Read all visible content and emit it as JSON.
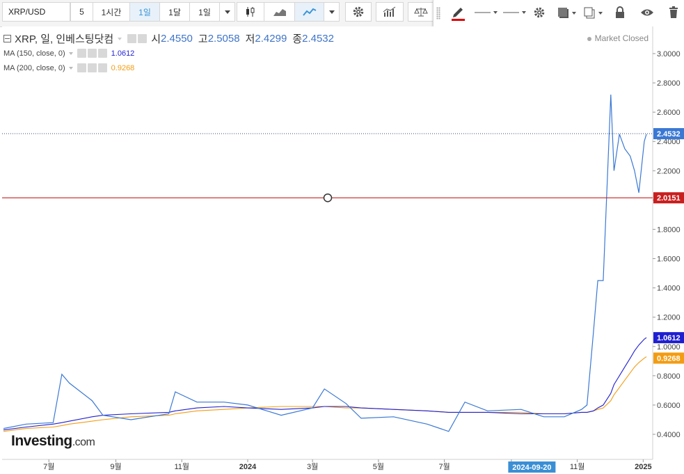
{
  "toolbar": {
    "symbol": "XRP/USD",
    "interval_buttons": [
      "5",
      "1시간",
      "1일",
      "1달",
      "1일"
    ],
    "active_interval": "1일"
  },
  "legend": {
    "title": "XRP, 일, 인베스팅닷컴",
    "open_label": "시",
    "open": "2.4550",
    "high_label": "고",
    "high": "2.5058",
    "low_label": "저",
    "low": "2.4299",
    "close_label": "종",
    "close": "2.4532",
    "ma150": {
      "label": "MA (150, close, 0)",
      "value": "1.0612"
    },
    "ma200": {
      "label": "MA (200, close, 0)",
      "value": "0.9268"
    }
  },
  "status": "Market Closed",
  "logo": {
    "brand": "Investing",
    "suffix": ".com"
  },
  "colors": {
    "price": "#3a78d4",
    "ma150": "#1f1fd1",
    "ma200": "#f39c12",
    "hline": "#c91f1f",
    "crosshair_label": "#3a8fd4"
  },
  "icons": [
    "candles-icon",
    "area-chart-icon",
    "line-chart-icon",
    "settings-gear-icon",
    "indicators-icon",
    "compare-scale-icon",
    "pencil-icon",
    "line-style-icon",
    "line-width-icon",
    "settings-gear-icon",
    "fill-icon",
    "clone-icon",
    "lock-icon",
    "eye-icon",
    "trash-icon"
  ],
  "chart_data": {
    "type": "line",
    "title": "XRP, 일, 인베스팅닷컴",
    "x_ticks": [
      "7월",
      "9월",
      "11월",
      "2024",
      "3월",
      "5월",
      "7월",
      "9",
      "11월",
      "2025"
    ],
    "crosshair_x_label": "2024-09-20",
    "y_ticks": [
      "3.0000",
      "2.8000",
      "2.6000",
      "2.4000",
      "2.2000",
      "2.0000",
      "1.8000",
      "1.6000",
      "1.4000",
      "1.2000",
      "1.0000",
      "0.8000",
      "0.6000",
      "0.4000"
    ],
    "ylim": [
      0.28,
      3.1
    ],
    "horizontal_line": {
      "value": 2.0151,
      "label": "2.0151"
    },
    "last_price": {
      "value": 2.4532,
      "label": "2.4532"
    },
    "x": [
      "2023-05-20",
      "2023-06-10",
      "2023-07-05",
      "2023-07-13",
      "2023-07-20",
      "2023-08-10",
      "2023-08-20",
      "2023-09-15",
      "2023-10-20",
      "2023-10-26",
      "2023-11-15",
      "2023-12-10",
      "2024-01-01",
      "2024-02-01",
      "2024-03-01",
      "2024-03-12",
      "2024-04-01",
      "2024-04-15",
      "2024-05-15",
      "2024-06-15",
      "2024-07-05",
      "2024-07-20",
      "2024-08-10",
      "2024-09-10",
      "2024-10-01",
      "2024-10-20",
      "2024-11-05",
      "2024-11-10",
      "2024-11-16",
      "2024-11-20",
      "2024-11-25",
      "2024-12-02",
      "2024-12-05",
      "2024-12-10",
      "2024-12-15",
      "2024-12-20",
      "2024-12-24",
      "2024-12-28",
      "2025-01-02",
      "2025-01-04"
    ],
    "series": [
      {
        "name": "XRP",
        "values": [
          0.44,
          0.47,
          0.48,
          0.81,
          0.75,
          0.63,
          0.53,
          0.5,
          0.54,
          0.69,
          0.62,
          0.62,
          0.6,
          0.53,
          0.58,
          0.71,
          0.61,
          0.51,
          0.52,
          0.47,
          0.42,
          0.62,
          0.56,
          0.57,
          0.52,
          0.52,
          0.57,
          0.6,
          1.1,
          1.45,
          1.45,
          2.72,
          2.2,
          2.45,
          2.35,
          2.3,
          2.2,
          2.05,
          2.4,
          2.45
        ]
      },
      {
        "name": "MA (150, close, 0)",
        "values": [
          0.43,
          0.45,
          0.47,
          0.48,
          0.49,
          0.52,
          0.53,
          0.54,
          0.55,
          0.56,
          0.58,
          0.59,
          0.58,
          0.57,
          0.58,
          0.59,
          0.59,
          0.58,
          0.57,
          0.56,
          0.55,
          0.55,
          0.55,
          0.54,
          0.54,
          0.54,
          0.55,
          0.55,
          0.56,
          0.58,
          0.6,
          0.68,
          0.74,
          0.8,
          0.86,
          0.92,
          0.97,
          1.01,
          1.05,
          1.06
        ]
      },
      {
        "name": "MA (200, close, 0)",
        "values": [
          0.42,
          0.44,
          0.45,
          0.46,
          0.47,
          0.49,
          0.5,
          0.52,
          0.53,
          0.54,
          0.56,
          0.57,
          0.58,
          0.59,
          0.59,
          0.59,
          0.58,
          0.58,
          0.57,
          0.56,
          0.55,
          0.55,
          0.55,
          0.55,
          0.54,
          0.54,
          0.55,
          0.55,
          0.56,
          0.57,
          0.58,
          0.63,
          0.67,
          0.72,
          0.77,
          0.82,
          0.86,
          0.89,
          0.92,
          0.93
        ]
      }
    ]
  }
}
